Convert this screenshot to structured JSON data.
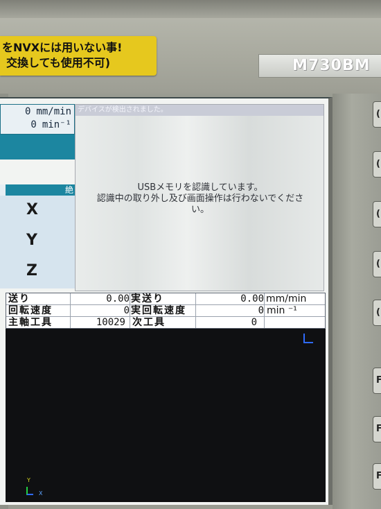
{
  "machine": {
    "warning_line1": "をNVXには用いない事!",
    "warning_line2": "交換しても使用不可)",
    "model": "M730BM",
    "side_keys": [
      "(",
      "(",
      "(",
      "(",
      "(",
      "F",
      "F",
      "F"
    ]
  },
  "top_box": {
    "feed_value": "0",
    "feed_unit": "mm/min",
    "spindle_value": "0",
    "spindle_unit": "min⁻¹"
  },
  "coord": {
    "header": "絶",
    "axes": [
      "X",
      "Y",
      "Z"
    ]
  },
  "dialog": {
    "title": "デバイスが検出されました。",
    "message_line1": "USBメモリを認識しています。",
    "message_line2": "認識中の取り外し及び画面操作は行わないでくださ",
    "message_line3": "い。"
  },
  "info": {
    "feed_label": "送り",
    "feed_value": "0.00",
    "actual_feed_label": "実送り",
    "actual_feed_value": "0.00",
    "actual_feed_unit": "mm/min",
    "spindle_label": "回転速度",
    "spindle_value": "0",
    "actual_spindle_label": "実回転速度",
    "actual_spindle_value": "0",
    "actual_spindle_unit": "min ⁻¹",
    "main_tool_label": "主軸工具",
    "main_tool_value": "10029",
    "next_tool_label": "次工具",
    "next_tool_value": "0"
  },
  "graphics": {
    "axis_y_label": "Y",
    "axis_x_label": "X"
  },
  "colors": {
    "accent_teal": "#1c86a0",
    "warning_yellow": "#e6c81e",
    "screen_bg": "#f2f4f2"
  }
}
